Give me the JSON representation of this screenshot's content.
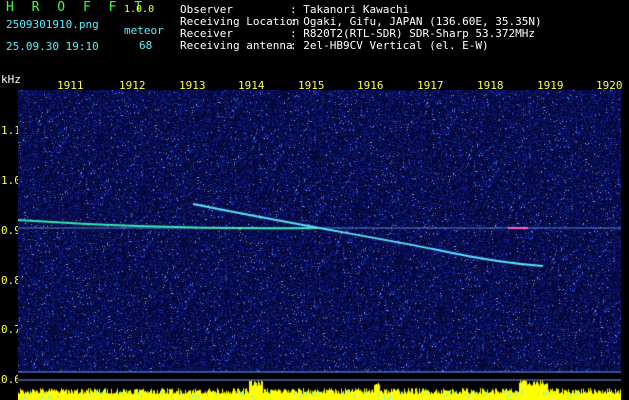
{
  "app": {
    "title": "H R O F F T",
    "version": "1.0.0"
  },
  "file": {
    "name": "2509301910.png",
    "datetime": "25.09.30 19:10"
  },
  "detection": {
    "mode": "meteor",
    "count": "68"
  },
  "info": [
    {
      "label": "Observer",
      "value": ": Takanori Kawachi"
    },
    {
      "label": "Receiving Location",
      "value": ": Ogaki, Gifu, JAPAN (136.60E, 35.35N)"
    },
    {
      "label": "Receiver",
      "value": ": R820T2(RTL-SDR) SDR-Sharp 53.372MHz"
    },
    {
      "label": "Receiving antenna",
      "value": ": 2el-HB9CV Vertical (el. E-W)"
    }
  ],
  "axes": {
    "y_unit": "kHz",
    "x_ticks": [
      "1911",
      "1912",
      "1913",
      "1914",
      "1915",
      "1916",
      "1917",
      "1918",
      "1919",
      "1920"
    ],
    "y_ticks": [
      "1.1",
      "1.0",
      "0.9",
      "0.8",
      "0.7",
      "0.6"
    ]
  },
  "colors": {
    "background": "#000000",
    "noise": "#1a2a8a",
    "signal": "#00ff88",
    "power_bar": "#ffff00"
  }
}
